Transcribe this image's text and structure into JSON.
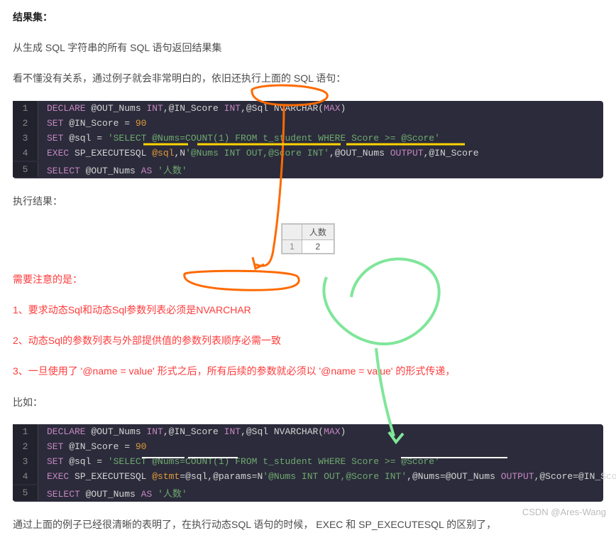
{
  "heading1": "结果集：",
  "p1": "从生成 SQL 字符串的所有 SQL 语句返回结果集",
  "p2": "看不懂没有关系，通过例子就会非常明白的，依旧还执行上面的 SQL 语句：",
  "code1": {
    "l1": {
      "a": "DECLARE",
      "b": " @OUT_Nums ",
      "c": "INT",
      "d": ",@IN_Score ",
      "e": "INT",
      "f": ",@Sql NVARCHAR(",
      "g": "MAX",
      "h": ")"
    },
    "l2": {
      "a": "SET",
      "b": " @IN_Score = ",
      "c": "90"
    },
    "l3": {
      "a": "SET",
      "b": " @sql = ",
      "c": "'SELECT @Nums=COUNT(1) FROM t_student WHERE Score >= @Score'"
    },
    "l4": {
      "a": "EXEC",
      "b": " SP_EXECUTESQL ",
      "c": "@sql",
      "d": ",N",
      "e": "'@Nums INT OUT,@Score INT'",
      "f": ",@OUT_Nums ",
      "g": "OUTPUT",
      "h": ",@IN_Score"
    },
    "l5": {
      "a": "SELECT",
      "b": " @OUT_Nums ",
      "c": "AS",
      "d": " ",
      "e": "'人数'"
    }
  },
  "p3": "执行结果：",
  "result": {
    "header": "人数",
    "idx": "1",
    "val": "2"
  },
  "notes_heading": "需要注意的是：",
  "note1": "1、要求动态Sql和动态Sql参数列表必须是NVARCHAR",
  "note2": "2、动态Sql的参数列表与外部提供值的参数列表顺序必需一致",
  "note3": "3、一旦使用了 '@name = value' 形式之后，所有后续的参数就必须以 '@name = value' 的形式传递，",
  "p4": "比如：",
  "code2": {
    "l1": {
      "a": "DECLARE",
      "b": " @OUT_Nums ",
      "c": "INT",
      "d": ",@IN_Score ",
      "e": "INT",
      "f": ",@Sql NVARCHAR(",
      "g": "MAX",
      "h": ")"
    },
    "l2": {
      "a": "SET",
      "b": " @IN_Score = ",
      "c": "90"
    },
    "l3": {
      "a": "SET",
      "b": " @sql = ",
      "c": "'SELECT @Nums=COUNT(1) FROM t_student WHERE Score >= @Score'"
    },
    "l4": {
      "a": "EXEC",
      "b": " SP_EXECUTESQL ",
      "c": "@stmt",
      "d": "=@sql,@params=",
      "e": "N",
      "f": "'@Nums INT OUT,@Score INT'",
      "g": ",@Nums=@OUT_Nums ",
      "h": "OUTPUT",
      "i": ",@Score=@IN_Score"
    },
    "l5": {
      "a": "SELECT",
      "b": " @OUT_Nums ",
      "c": "AS",
      "d": " ",
      "e": "'人数'"
    }
  },
  "p5": "通过上面的例子已经很清晰的表明了，在执行动态SQL 语句的时候， EXEC 和  SP_EXECUTESQL 的区别了，",
  "watermark": "CSDN @Ares-Wang"
}
